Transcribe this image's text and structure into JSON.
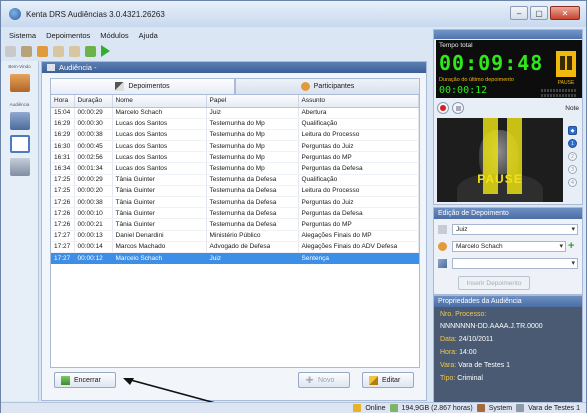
{
  "window": {
    "title": "Kenta DRS Audiências 3.0.4321.26263"
  },
  "menu": [
    "Sistema",
    "Depoimentos",
    "Módulos",
    "Ajuda"
  ],
  "leftnav": {
    "label_top": "Bem-Vindo",
    "label_mid": "Audiência"
  },
  "main": {
    "header": "Audiência -",
    "tabs": [
      "Depoimentos",
      "Participantes"
    ],
    "columns": [
      "Hora",
      "Duração",
      "Nome",
      "Papel",
      "Assunto"
    ],
    "rows": [
      [
        "15:04",
        "00:00:29",
        "Marcelo Schach",
        "Juiz",
        "Abertura"
      ],
      [
        "16:29",
        "00:00:30",
        "Lucas dos Santos",
        "Testemunha do Mp",
        "Qualificação"
      ],
      [
        "16:29",
        "00:00:38",
        "Lucas dos Santos",
        "Testemunha do Mp",
        "Leitura do Processo"
      ],
      [
        "16:30",
        "00:00:45",
        "Lucas dos Santos",
        "Testemunha do Mp",
        "Perguntas do Juiz"
      ],
      [
        "16:31",
        "00:02:56",
        "Lucas dos Santos",
        "Testemunha do Mp",
        "Perguntas do MP"
      ],
      [
        "16:34",
        "00:01:34",
        "Lucas dos Santos",
        "Testemunha do Mp",
        "Perguntas da Defesa"
      ],
      [
        "17:25",
        "00:00:29",
        "Tânia Guinter",
        "Testemunha da Defesa",
        "Qualificação"
      ],
      [
        "17:25",
        "00:00:20",
        "Tânia Guinter",
        "Testemunha da Defesa",
        "Leitura do Processo"
      ],
      [
        "17:26",
        "00:00:38",
        "Tânia Guinter",
        "Testemunha da Defesa",
        "Perguntas do Juiz"
      ],
      [
        "17:26",
        "00:00:10",
        "Tânia Guinter",
        "Testemunha da Defesa",
        "Perguntas da Defesa"
      ],
      [
        "17:26",
        "00:00:21",
        "Tânia Guinter",
        "Testemunha da Defesa",
        "Perguntas do MP"
      ],
      [
        "17:27",
        "00:00:13",
        "Daniel Denardini",
        "Ministério Público",
        "Alegações Finais do MP"
      ],
      [
        "17:27",
        "00:00:14",
        "Marcos Machado",
        "Advogado de Defesa",
        "Alegações Finais do ADV Defesa"
      ],
      [
        "17:27",
        "00:00:12",
        "Marcelo Schach",
        "Juiz",
        "Sentença"
      ]
    ],
    "selected_row": 13,
    "buttons": {
      "encerrar": "Encerrar",
      "novo": "Novo",
      "editar": "Editar"
    }
  },
  "recorder": {
    "tempo_label": "Tempo total",
    "tempo_total": "00:09:48",
    "ultimo_label": "Duração do último depoimento",
    "ultimo": "00:00:12",
    "pause_label": "PAUSE",
    "note_label": "Note",
    "video_overlay": "PAUSE",
    "side_buttons": [
      "1",
      "2",
      "3",
      "4"
    ]
  },
  "edicao": {
    "title": "Edição de Depoimento",
    "assunto": "Juiz",
    "participante": "Marcelo Schach",
    "empty_select": "",
    "inserir_button": "Inserir Depoimento"
  },
  "propriedades": {
    "title": "Propriedades da Audiência",
    "processo_label": "Nro. Processo:",
    "processo": "NNNNNNN-DD.AAAA.J.TR.0000",
    "data_label": "Data:",
    "data": "24/10/2011",
    "hora_label": "Hora:",
    "hora": "14:00",
    "vara_label": "Vara:",
    "vara": "Vara de Testes 1",
    "tipo_label": "Tipo:",
    "tipo": "Criminal"
  },
  "status": {
    "online": "Online",
    "storage": "194,9GB (2.867 horas)",
    "user": "System",
    "vara": "Vara de Testes 1"
  },
  "colors": {
    "accent": "#3c8ee6",
    "clock_green": "#2fe81a",
    "pause_yellow": "#f2b90c",
    "props_bg": "#4a5a73"
  }
}
